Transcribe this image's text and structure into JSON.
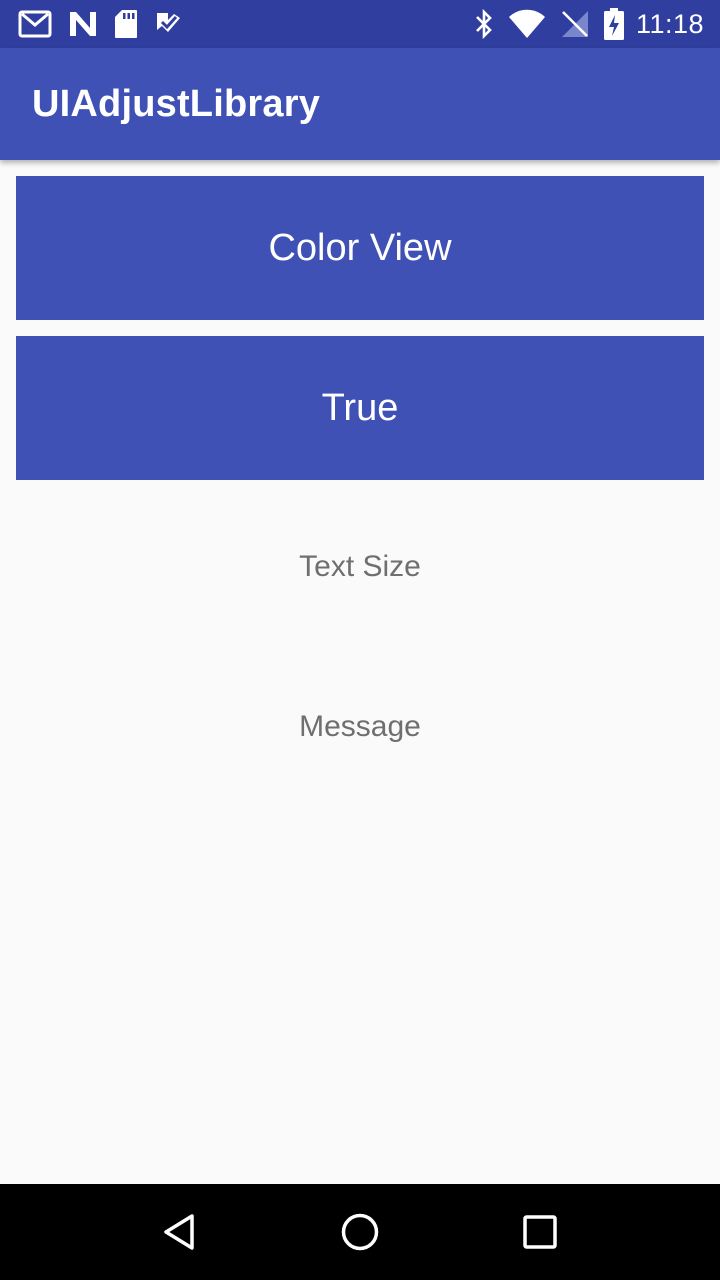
{
  "status_bar": {
    "time": "11:18",
    "left_icons": [
      "gmail-icon",
      "n-app-icon",
      "sd-card-icon",
      "check-app-icon"
    ],
    "right_icons": [
      "bluetooth-icon",
      "wifi-icon",
      "no-signal-icon",
      "battery-charging-icon"
    ],
    "background": "#303f9f"
  },
  "app_bar": {
    "title": "UIAdjustLibrary",
    "background": "#3f51b5"
  },
  "main": {
    "color_view_button": "Color View",
    "toggle_button": "True",
    "text_size_label": "Text Size",
    "message_label": "Message",
    "accent_color": "#3f51b5",
    "label_color": "#6f6f6f"
  },
  "nav_bar": {
    "buttons": [
      "back-icon",
      "home-icon",
      "recents-icon"
    ]
  }
}
